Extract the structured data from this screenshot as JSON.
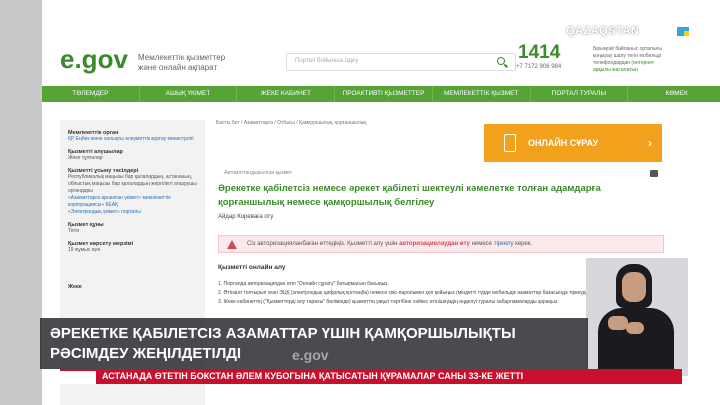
{
  "channel": {
    "name": "QAZAQSTAN"
  },
  "header": {
    "logo": "e.gov",
    "tagline": "Мемлекеттік қызметтер және онлайн ақпарат",
    "search_placeholder": "Портал бойынша іздеу",
    "hotline": "1414",
    "phone": "+7 7172 906 984",
    "hotline_note_a": "Бірыңғай байланыс орталығы қоңырау шалу тегін мобильді телефондардан ",
    "hotline_note_link": "(интернет арқылы жасалатын"
  },
  "nav": [
    "ТӨЛЕМДЕР",
    "АШЫҚ ҮКІМЕТ",
    "ЖЕКЕ КАБИНЕТ",
    "ПРОАКТИВТІ ҚЫЗМЕТТЕР",
    "МЕМЛЕКЕТТІК ҚЫЗМЕТ РЕЕСТРІ",
    "ПОРТАЛ ТУРАЛЫ",
    "КӨМЕК"
  ],
  "sidebar": {
    "provider_label": "Мемлекеттік орган",
    "provider_value": "ҚР Еңбек және халықты әлеуметтік қорғау министрлігі",
    "recipients_label": "Қызметті алушылар",
    "recipients_value": "Жеке тұлғалар",
    "channels_label": "Қызметті ұсыну тәсілдері",
    "channels_value": "Республикалық маңызы бар қалалардың, астананың, облыстық маңызы бар қалалардың жергілікті атқарушы органдары",
    "channel2": "«Азаматтарға арналған үкімет» мемлекеттік корпорациясы» КЕАҚ",
    "channel3": "«Электрондық үкімет» порталы",
    "cost_label": "Қызмет құны",
    "cost_value": "Тегін",
    "term_label": "Қызмет көрсету мерзімі",
    "term_value": "19 жұмыс күні",
    "bottom_label": "Жеке"
  },
  "main": {
    "breadcrumb": "Басты бет / Азаматтарға / Отбасы / Қамқоршылық, қорғаншылық",
    "online_btn": "ОНЛАЙН СҰРАУ",
    "online_tag": "Автоматтандырылған қызмет",
    "title": "Әрекетке қабілетсіз немесе әрекет қабілеті шектеулі кәмелетке толған адамдарға қорғаншылық немесе қамқоршылық белгілеу",
    "subtitle": "Айдар Кореваға оту",
    "alert_a": "Сіз авторизацияланбаған өттедіңіз. Қызметті алу үшін ",
    "alert_b": "авторизациялаудан өту",
    "alert_c": " немесе ",
    "alert_d": "тіркелу",
    "alert_e": " керек.",
    "section": "Қызметті онлайн алу",
    "step1": "1. Порталда авторизациядан өтіп \"Онлайн сұрату\" батырмасын басыңыз.",
    "step2": "2. Өтінішті толтырып оған ЭЦҚ (электрондық цифрлық қолтаңба) немесе смс-парольмен қол қойыңыз (міндетті түрде мобильдік азаматтар базасында тіркеуде бар болу қажет).",
    "step3": "3. Жеке кабинеттің (\"Қызметтерді алу тарихы\" бөлімінде) қызметтің уақыт тәртібіне сәйкес өтінішіңіздің өңделуі туралы хабарламаларды қараңыз."
  },
  "overlay": {
    "headline_line1": "ӘРЕКЕТКЕ ҚАБІЛЕТСІЗ АЗАМАТТАР ҮШІН ҚАМҚОРШЫЛЫҚТЫ",
    "headline_line2": "РӘСІМДЕУ ЖЕҢІЛДЕТІЛДІ",
    "ticker": "АСТАНАДА ӨТЕТІН БОКСТАН ӘЛЕМ КУБОГЫНА ҚАТЫСАТЫН ҚҰРАМАЛАР САНЫ 33-КЕ ЖЕТТІ",
    "watermark": "e.gov"
  },
  "colors": {
    "accent": "#3b8a2b",
    "nav": "#56a336",
    "orange": "#f2a11c",
    "ticker": "#c8102e"
  }
}
